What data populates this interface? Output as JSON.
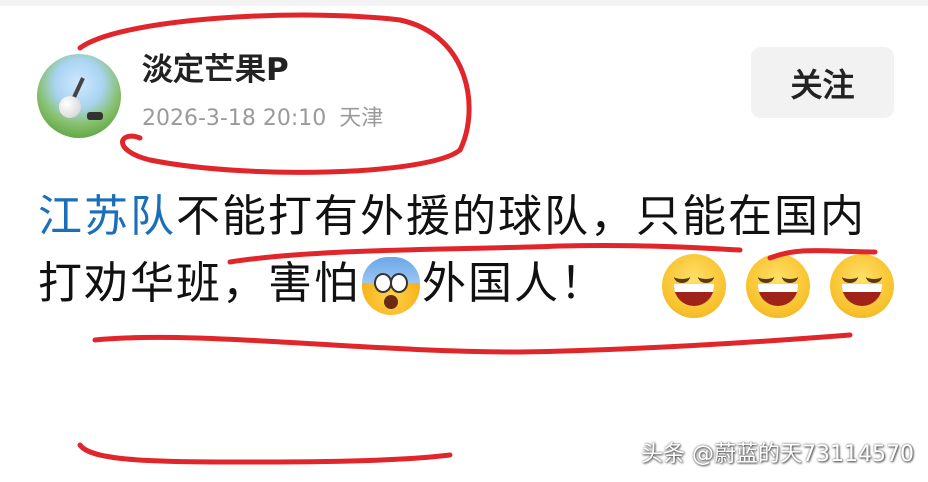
{
  "post": {
    "username": "淡定芒果P",
    "date": "2026-3-18 20:10",
    "location": "天津",
    "follow_label": "关注",
    "hashtag": "江苏队",
    "text_part1": "不能打有外援的球队，只能在国内打劝华班，害怕",
    "text_part2": "外国人！"
  },
  "emojis": [
    "shocked-face",
    "laughing-face",
    "laughing-face",
    "laughing-face"
  ],
  "watermark": "头条 @蔚蓝的天73114570",
  "colors": {
    "hashtag": "#1a6fb8",
    "annotation": "#e0262a",
    "follow_button_bg": "#f2f2f2"
  }
}
